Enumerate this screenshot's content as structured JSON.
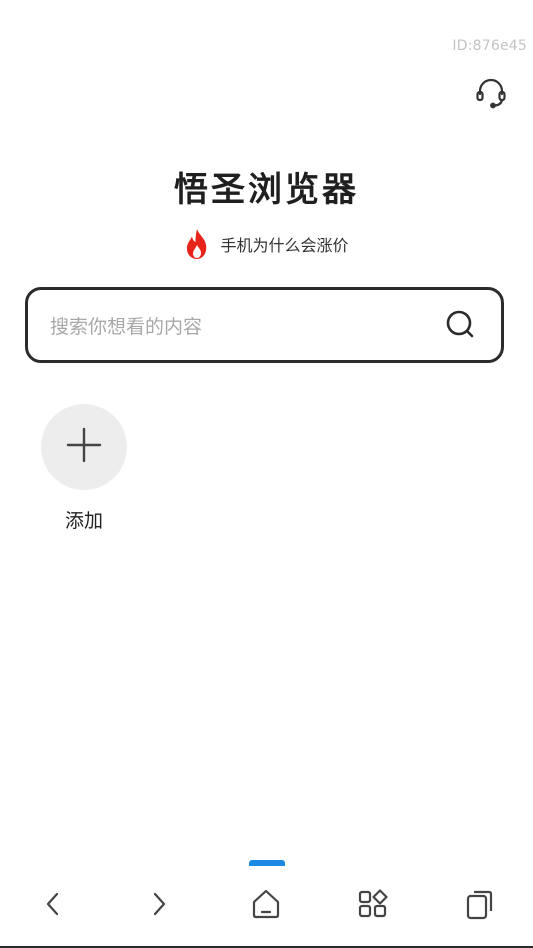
{
  "status": {
    "device_id": "ID:876e45"
  },
  "header": {
    "support_icon": "headset-icon"
  },
  "brand": {
    "title": "悟圣浏览器"
  },
  "hot_search": {
    "icon": "flame-icon",
    "icon_color": "#e8231a",
    "text": "手机为什么会涨价"
  },
  "search": {
    "placeholder": "搜索你想看的内容",
    "icon": "search-icon"
  },
  "shortcuts": {
    "add": {
      "icon": "plus-icon",
      "label": "添加"
    }
  },
  "bottom_nav": {
    "active_color": "#1e88e5",
    "items": [
      {
        "name": "back",
        "icon": "chevron-left-icon"
      },
      {
        "name": "forward",
        "icon": "chevron-right-icon"
      },
      {
        "name": "home",
        "icon": "home-icon",
        "active": true
      },
      {
        "name": "apps",
        "icon": "apps-grid-icon"
      },
      {
        "name": "tabs",
        "icon": "tabs-icon"
      }
    ]
  }
}
